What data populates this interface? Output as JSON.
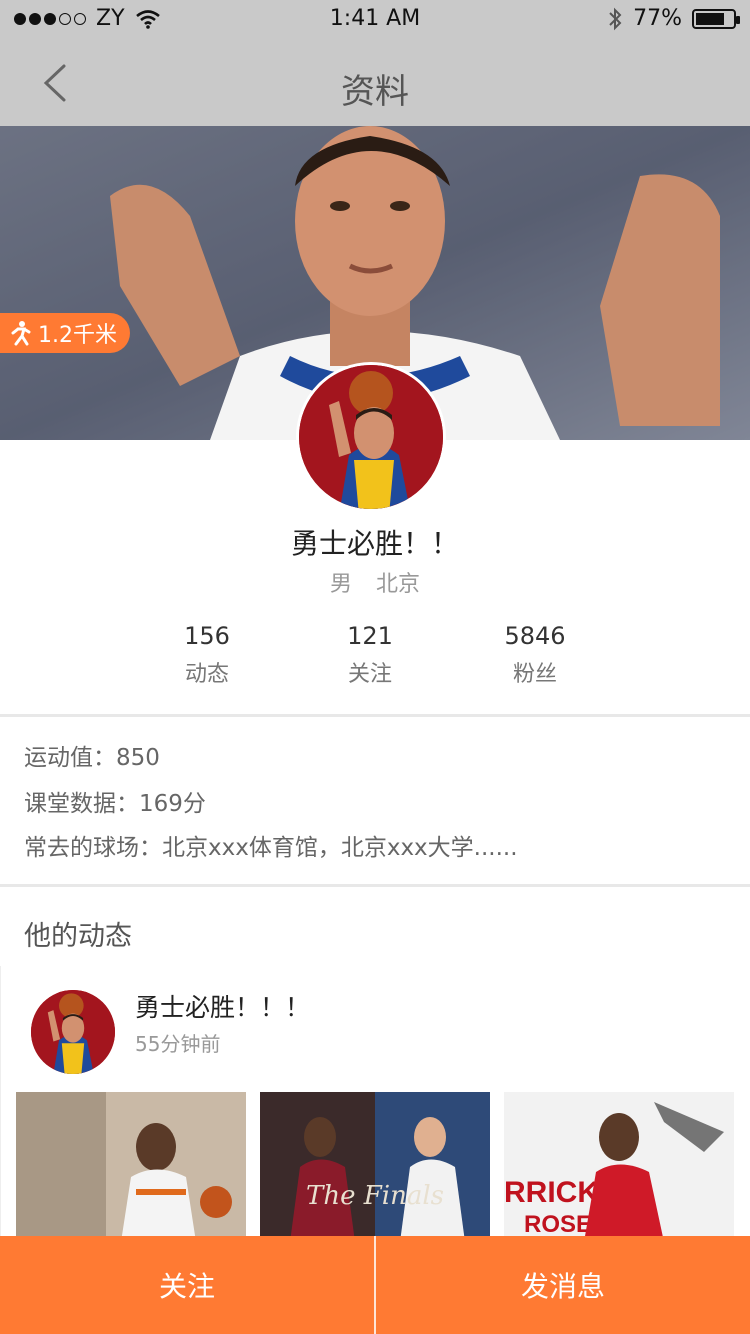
{
  "status_bar": {
    "carrier": "ZY",
    "time": "1:41 AM",
    "battery_percent": "77%",
    "battery_level": 0.77
  },
  "nav": {
    "title": "资料"
  },
  "hero": {
    "distance": "1.2千米"
  },
  "profile": {
    "name": "勇士必胜！！",
    "gender": "男",
    "city": "北京"
  },
  "stats": [
    {
      "num": "156",
      "label": "动态"
    },
    {
      "num": "121",
      "label": "关注"
    },
    {
      "num": "5846",
      "label": "粉丝"
    }
  ],
  "info": {
    "sport_value": "运动值：850",
    "class_data": "课堂数据：169分",
    "frequent_courts": "常去的球场：北京xxx体育馆，北京xxx大学......"
  },
  "section": {
    "title": "他的动态"
  },
  "post": {
    "title": "勇士必胜！！！",
    "time": "55分钟前"
  },
  "bottom": {
    "follow": "关注",
    "message": "发消息"
  },
  "colors": {
    "accent": "#ff7a33",
    "header_bg": "#c9c9c9"
  }
}
